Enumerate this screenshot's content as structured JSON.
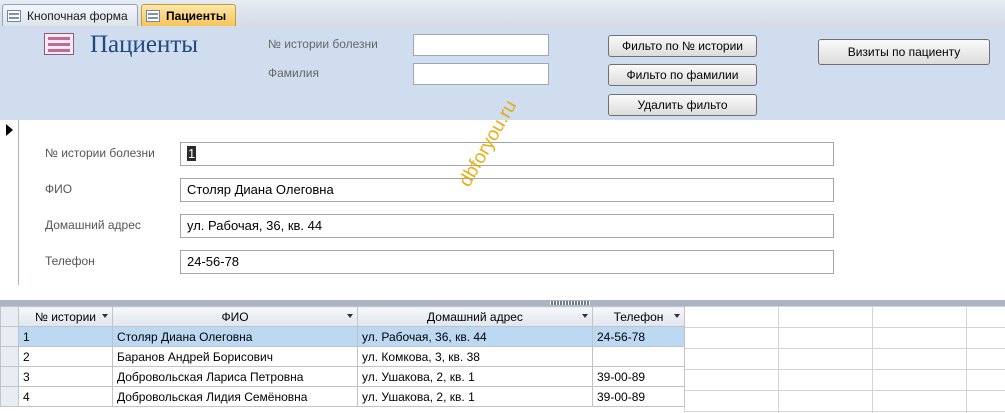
{
  "tabs": [
    {
      "label": "Кнопочная форма"
    },
    {
      "label": "Пациенты"
    }
  ],
  "header": {
    "title": "Пациенты",
    "history_label": "№ истории болезни",
    "history_value": "",
    "surname_label": "Фамилия",
    "surname_value": "",
    "btn_filter_history": "Фильто по № истории",
    "btn_filter_surname": "Фильто по фамилии",
    "btn_remove_filter": "Удалить фильто",
    "btn_visits": "Визиты по пациенту"
  },
  "detail": {
    "history": {
      "label": "№ истории болезни",
      "value": "1"
    },
    "fio": {
      "label": "ФИО",
      "value": "Столяр Диана Олеговна"
    },
    "address": {
      "label": "Домашний адрес",
      "value": "ул. Рабочая, 36, кв. 44"
    },
    "phone": {
      "label": "Телефон",
      "value": "24-56-78"
    }
  },
  "watermark": "dbforyou.ru",
  "grid": {
    "columns": [
      "№ истории",
      "ФИО",
      "Домашний адрес",
      "Телефон"
    ],
    "rows": [
      [
        "1",
        "Столяр Диана Олеговна",
        "ул. Рабочая, 36, кв. 44",
        "24-56-78"
      ],
      [
        "2",
        "Баранов Андрей Борисович",
        "ул. Комкова, 3, кв. 38",
        ""
      ],
      [
        "3",
        "Добровольская Лариса Петровна",
        "ул. Ушакова, 2, кв. 1",
        "39-00-89"
      ],
      [
        "4",
        "Добровольская Лидия Семёновна",
        "ул. Ушакова, 2, кв. 1",
        "39-00-89"
      ]
    ]
  },
  "colors": {
    "header_bg": "#cfddef",
    "title": "#1f4a80",
    "selected_row": "#bcd9f3",
    "watermark": "#e5a700"
  }
}
